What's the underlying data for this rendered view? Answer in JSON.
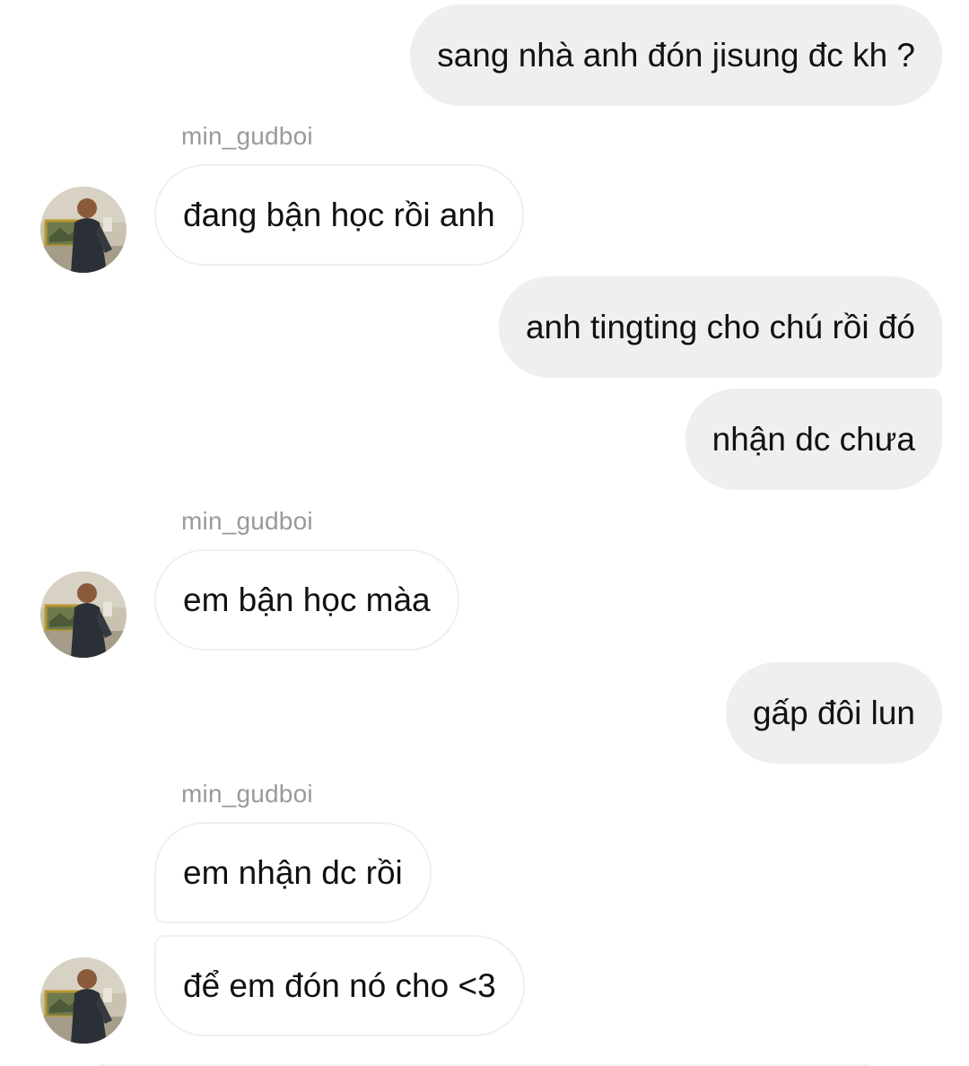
{
  "conversation": {
    "messages": [
      {
        "text": "sang nhà anh đón jisung đc kh ?"
      },
      {
        "sender": "min_gudboi",
        "text": "đang bận học rồi anh"
      },
      {
        "text": "anh tingting cho chú rồi đó"
      },
      {
        "text": "nhận dc chưa"
      },
      {
        "sender": "min_gudboi",
        "text": "em bận học màa"
      },
      {
        "text": "gấp đôi lun"
      },
      {
        "sender": "min_gudboi",
        "text": "em nhận dc rồi"
      },
      {
        "text": "để em đón nó cho <3"
      }
    ]
  },
  "icons": {
    "avatar": "profile-photo-icon"
  },
  "colors": {
    "sent_bubble": "#efefef",
    "received_border": "#efefef",
    "sender_name": "#9a9a9a",
    "text": "#111111"
  }
}
